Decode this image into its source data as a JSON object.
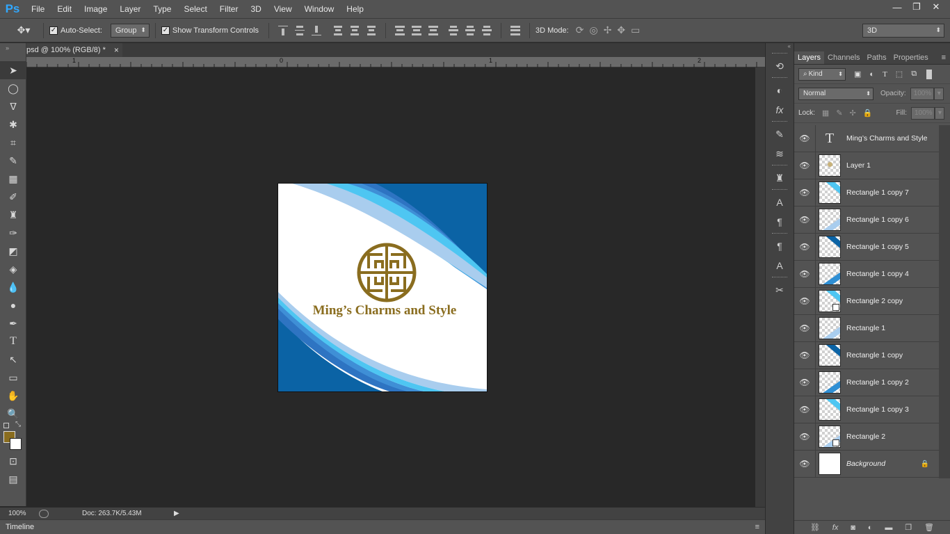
{
  "app": {
    "logo": "Ps"
  },
  "menu": [
    "File",
    "Edit",
    "Image",
    "Layer",
    "Type",
    "Select",
    "Filter",
    "3D",
    "View",
    "Window",
    "Help"
  ],
  "window_controls": [
    "—",
    "❐",
    "✕"
  ],
  "options": {
    "auto_select_label": "Auto-Select:",
    "auto_select_checked": true,
    "group_value": "Group",
    "show_transform_label": "Show Transform Controls",
    "show_transform_checked": true,
    "mode3d_label": "3D Mode:",
    "workspace_value": "3D"
  },
  "document": {
    "tab_title": "psd @ 100% (RGB/8) *",
    "close_glyph": "×",
    "ruler_labels": [
      "1",
      "0",
      "1",
      "2"
    ],
    "logo_text": "Ming’s Charms and Style",
    "logo_color": "#8a6d1f"
  },
  "status": {
    "zoom": "100%",
    "doc_info": "Doc: 263.7K/5.43M"
  },
  "timeline": {
    "label": "Timeline"
  },
  "colors": {
    "foreground": "#8a6d1f",
    "background": "#ffffff",
    "wave_dark": "#0b63a5",
    "wave_mid": "#2f8fd4",
    "wave_cyan": "#4ec6f2",
    "wave_light": "#a9cdee"
  },
  "layers_panel": {
    "tabs": [
      "Layers",
      "Channels",
      "Paths",
      "Properties"
    ],
    "kind_label": "Kind",
    "blend_mode": "Normal",
    "opacity_label": "Opacity:",
    "opacity_value": "100%",
    "lock_label": "Lock:",
    "fill_label": "Fill:",
    "fill_value": "100%",
    "layers": [
      {
        "name": "Ming’s Charms and Style",
        "kind": "text"
      },
      {
        "name": "Layer 1",
        "kind": "logo"
      },
      {
        "name": "Rectangle 1 copy 7",
        "kind": "shape"
      },
      {
        "name": "Rectangle 1 copy 6",
        "kind": "shape"
      },
      {
        "name": "Rectangle 1 copy 5",
        "kind": "shape"
      },
      {
        "name": "Rectangle 1 copy 4",
        "kind": "shape"
      },
      {
        "name": "Rectangle 2 copy",
        "kind": "shape2"
      },
      {
        "name": "Rectangle 1",
        "kind": "shape"
      },
      {
        "name": "Rectangle 1 copy",
        "kind": "shape"
      },
      {
        "name": "Rectangle 1 copy 2",
        "kind": "shape"
      },
      {
        "name": "Rectangle 1 copy 3",
        "kind": "shape"
      },
      {
        "name": "Rectangle 2",
        "kind": "shape2"
      },
      {
        "name": "Background",
        "kind": "background"
      }
    ]
  }
}
